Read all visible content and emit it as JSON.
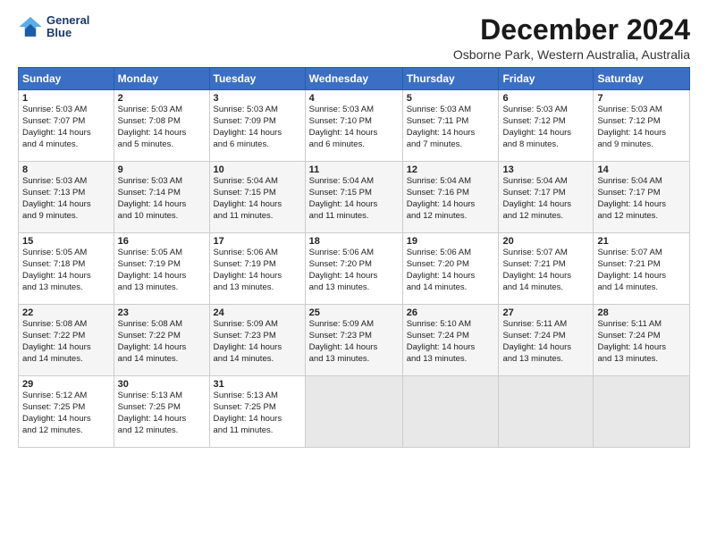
{
  "logo": {
    "line1": "General",
    "line2": "Blue"
  },
  "title": "December 2024",
  "location": "Osborne Park, Western Australia, Australia",
  "days_of_week": [
    "Sunday",
    "Monday",
    "Tuesday",
    "Wednesday",
    "Thursday",
    "Friday",
    "Saturday"
  ],
  "weeks": [
    [
      {
        "day": "1",
        "info": "Sunrise: 5:03 AM\nSunset: 7:07 PM\nDaylight: 14 hours\nand 4 minutes."
      },
      {
        "day": "2",
        "info": "Sunrise: 5:03 AM\nSunset: 7:08 PM\nDaylight: 14 hours\nand 5 minutes."
      },
      {
        "day": "3",
        "info": "Sunrise: 5:03 AM\nSunset: 7:09 PM\nDaylight: 14 hours\nand 6 minutes."
      },
      {
        "day": "4",
        "info": "Sunrise: 5:03 AM\nSunset: 7:10 PM\nDaylight: 14 hours\nand 6 minutes."
      },
      {
        "day": "5",
        "info": "Sunrise: 5:03 AM\nSunset: 7:11 PM\nDaylight: 14 hours\nand 7 minutes."
      },
      {
        "day": "6",
        "info": "Sunrise: 5:03 AM\nSunset: 7:12 PM\nDaylight: 14 hours\nand 8 minutes."
      },
      {
        "day": "7",
        "info": "Sunrise: 5:03 AM\nSunset: 7:12 PM\nDaylight: 14 hours\nand 9 minutes."
      }
    ],
    [
      {
        "day": "8",
        "info": "Sunrise: 5:03 AM\nSunset: 7:13 PM\nDaylight: 14 hours\nand 9 minutes."
      },
      {
        "day": "9",
        "info": "Sunrise: 5:03 AM\nSunset: 7:14 PM\nDaylight: 14 hours\nand 10 minutes."
      },
      {
        "day": "10",
        "info": "Sunrise: 5:04 AM\nSunset: 7:15 PM\nDaylight: 14 hours\nand 11 minutes."
      },
      {
        "day": "11",
        "info": "Sunrise: 5:04 AM\nSunset: 7:15 PM\nDaylight: 14 hours\nand 11 minutes."
      },
      {
        "day": "12",
        "info": "Sunrise: 5:04 AM\nSunset: 7:16 PM\nDaylight: 14 hours\nand 12 minutes."
      },
      {
        "day": "13",
        "info": "Sunrise: 5:04 AM\nSunset: 7:17 PM\nDaylight: 14 hours\nand 12 minutes."
      },
      {
        "day": "14",
        "info": "Sunrise: 5:04 AM\nSunset: 7:17 PM\nDaylight: 14 hours\nand 12 minutes."
      }
    ],
    [
      {
        "day": "15",
        "info": "Sunrise: 5:05 AM\nSunset: 7:18 PM\nDaylight: 14 hours\nand 13 minutes."
      },
      {
        "day": "16",
        "info": "Sunrise: 5:05 AM\nSunset: 7:19 PM\nDaylight: 14 hours\nand 13 minutes."
      },
      {
        "day": "17",
        "info": "Sunrise: 5:06 AM\nSunset: 7:19 PM\nDaylight: 14 hours\nand 13 minutes."
      },
      {
        "day": "18",
        "info": "Sunrise: 5:06 AM\nSunset: 7:20 PM\nDaylight: 14 hours\nand 13 minutes."
      },
      {
        "day": "19",
        "info": "Sunrise: 5:06 AM\nSunset: 7:20 PM\nDaylight: 14 hours\nand 14 minutes."
      },
      {
        "day": "20",
        "info": "Sunrise: 5:07 AM\nSunset: 7:21 PM\nDaylight: 14 hours\nand 14 minutes."
      },
      {
        "day": "21",
        "info": "Sunrise: 5:07 AM\nSunset: 7:21 PM\nDaylight: 14 hours\nand 14 minutes."
      }
    ],
    [
      {
        "day": "22",
        "info": "Sunrise: 5:08 AM\nSunset: 7:22 PM\nDaylight: 14 hours\nand 14 minutes."
      },
      {
        "day": "23",
        "info": "Sunrise: 5:08 AM\nSunset: 7:22 PM\nDaylight: 14 hours\nand 14 minutes."
      },
      {
        "day": "24",
        "info": "Sunrise: 5:09 AM\nSunset: 7:23 PM\nDaylight: 14 hours\nand 14 minutes."
      },
      {
        "day": "25",
        "info": "Sunrise: 5:09 AM\nSunset: 7:23 PM\nDaylight: 14 hours\nand 13 minutes."
      },
      {
        "day": "26",
        "info": "Sunrise: 5:10 AM\nSunset: 7:24 PM\nDaylight: 14 hours\nand 13 minutes."
      },
      {
        "day": "27",
        "info": "Sunrise: 5:11 AM\nSunset: 7:24 PM\nDaylight: 14 hours\nand 13 minutes."
      },
      {
        "day": "28",
        "info": "Sunrise: 5:11 AM\nSunset: 7:24 PM\nDaylight: 14 hours\nand 13 minutes."
      }
    ],
    [
      {
        "day": "29",
        "info": "Sunrise: 5:12 AM\nSunset: 7:25 PM\nDaylight: 14 hours\nand 12 minutes."
      },
      {
        "day": "30",
        "info": "Sunrise: 5:13 AM\nSunset: 7:25 PM\nDaylight: 14 hours\nand 12 minutes."
      },
      {
        "day": "31",
        "info": "Sunrise: 5:13 AM\nSunset: 7:25 PM\nDaylight: 14 hours\nand 11 minutes."
      },
      {
        "day": "",
        "info": ""
      },
      {
        "day": "",
        "info": ""
      },
      {
        "day": "",
        "info": ""
      },
      {
        "day": "",
        "info": ""
      }
    ]
  ]
}
